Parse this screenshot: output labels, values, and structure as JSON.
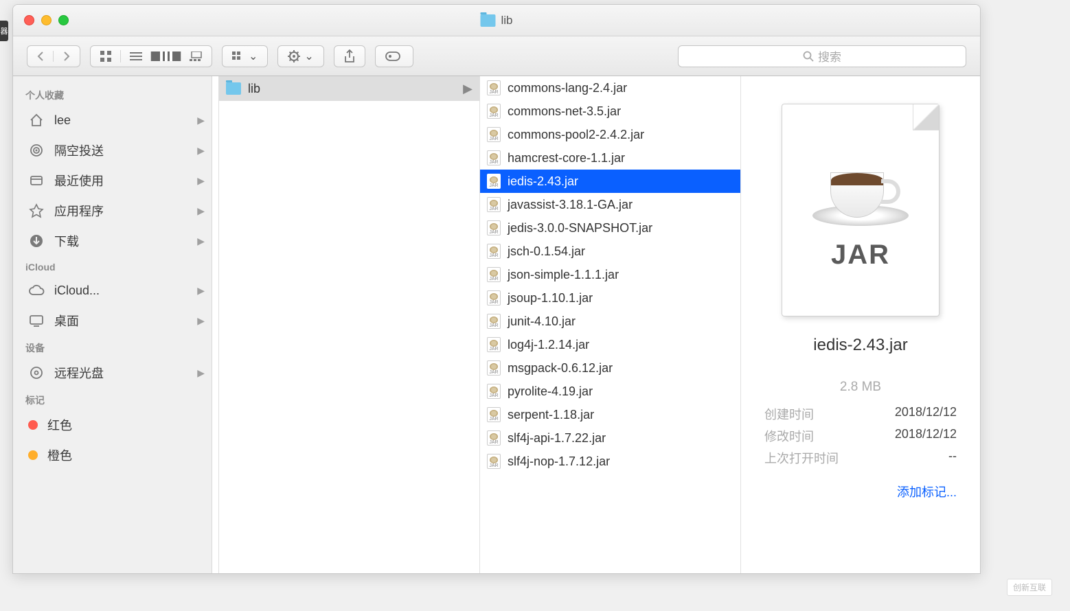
{
  "window": {
    "title": "lib"
  },
  "toolbar": {
    "search_placeholder": "搜索"
  },
  "sidebar": {
    "groups": [
      {
        "label": "个人收藏",
        "items": [
          {
            "icon": "home",
            "label": "lee"
          },
          {
            "icon": "airdrop",
            "label": "隔空投送"
          },
          {
            "icon": "recent",
            "label": "最近使用"
          },
          {
            "icon": "apps",
            "label": "应用程序"
          },
          {
            "icon": "download",
            "label": "下载"
          }
        ]
      },
      {
        "label": "iCloud",
        "items": [
          {
            "icon": "cloud",
            "label": "iCloud..."
          },
          {
            "icon": "desktop",
            "label": "桌面"
          }
        ]
      },
      {
        "label": "设备",
        "items": [
          {
            "icon": "disc",
            "label": "远程光盘"
          }
        ]
      },
      {
        "label": "标记",
        "items": [
          {
            "icon": "tag-red",
            "label": "红色"
          },
          {
            "icon": "tag-orange",
            "label": "橙色"
          }
        ]
      }
    ]
  },
  "column1": {
    "folder": "lib"
  },
  "column2": {
    "files": [
      "commons-lang-2.4.jar",
      "commons-net-3.5.jar",
      "commons-pool2-2.4.2.jar",
      "hamcrest-core-1.1.jar",
      "iedis-2.43.jar",
      "javassist-3.18.1-GA.jar",
      "jedis-3.0.0-SNAPSHOT.jar",
      "jsch-0.1.54.jar",
      "json-simple-1.1.1.jar",
      "jsoup-1.10.1.jar",
      "junit-4.10.jar",
      "log4j-1.2.14.jar",
      "msgpack-0.6.12.jar",
      "pyrolite-4.19.jar",
      "serpent-1.18.jar",
      "slf4j-api-1.7.22.jar",
      "slf4j-nop-1.7.12.jar"
    ],
    "selected_index": 4
  },
  "preview": {
    "thumb_label": "JAR",
    "filename": "iedis-2.43.jar",
    "size": "2.8 MB",
    "rows": [
      {
        "k": "创建时间",
        "v": "2018/12/12"
      },
      {
        "k": "修改时间",
        "v": "2018/12/12"
      },
      {
        "k": "上次打开时间",
        "v": "--"
      }
    ],
    "add_tag": "添加标记..."
  },
  "watermark": "创新互联"
}
